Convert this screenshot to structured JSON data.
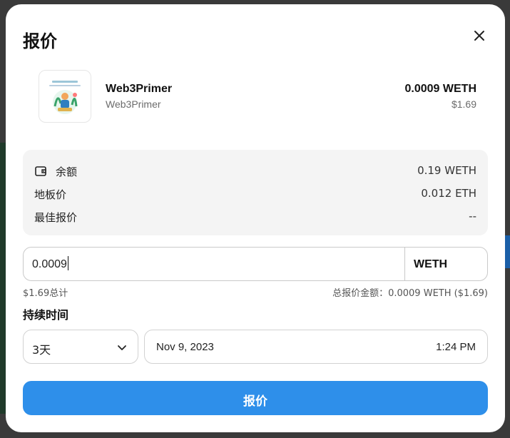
{
  "modal": {
    "title": "报价"
  },
  "item": {
    "name": "Web3Primer",
    "collection": "Web3Primer",
    "price": "0.0009 WETH",
    "price_usd": "$1.69"
  },
  "info": {
    "balance_label": "余额",
    "balance_value": "0.19 WETH",
    "floor_label": "地板价",
    "floor_value": "0.012 ETH",
    "best_offer_label": "最佳报价",
    "best_offer_value": "--"
  },
  "offer": {
    "amount": "0.0009",
    "currency": "WETH",
    "total_usd": "$1.69总计",
    "total_summary": "总报价金额：0.0009 WETH ($1.69)"
  },
  "duration": {
    "label": "持续时间",
    "selected": "3天",
    "date": "Nov 9, 2023",
    "time": "1:24 PM"
  },
  "submit_label": "报价",
  "colors": {
    "accent": "#2e8fea",
    "info_bg": "#f4f4f4"
  }
}
